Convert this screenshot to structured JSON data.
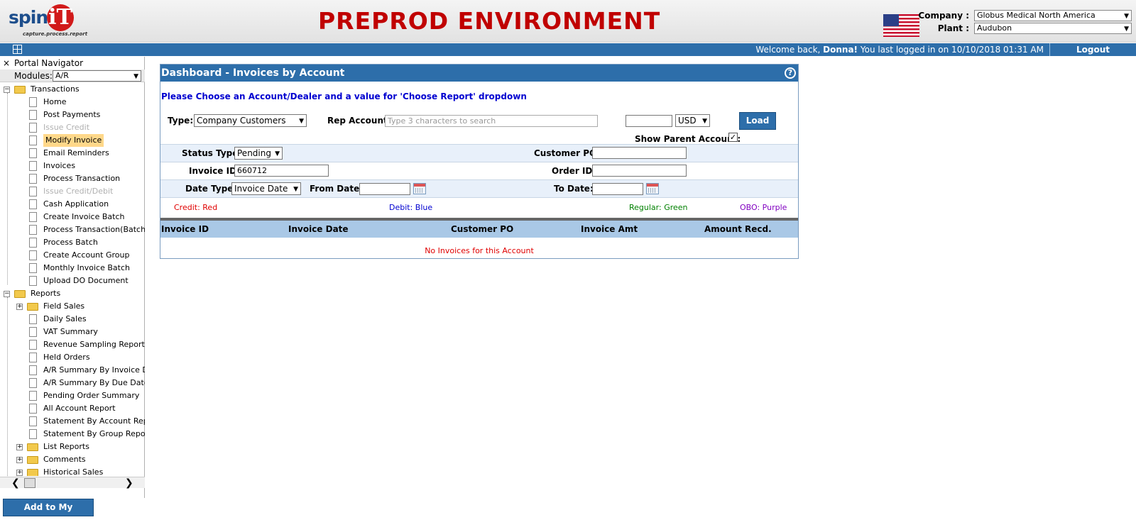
{
  "header": {
    "logo_text": "spine",
    "logo_mark": "iT",
    "logo_tagline": "capture.process.report",
    "environment_banner": "PREPROD ENVIRONMENT",
    "flag_icon": "us-flag-icon",
    "company_label": "Company :",
    "company_value": "Globus Medical North America",
    "plant_label": "Plant :",
    "plant_value": "Audubon"
  },
  "topbar": {
    "welcome_prefix": "Welcome back, ",
    "user_name": "Donna!",
    "welcome_suffix": " You last logged in on 10/10/2018 01:31 AM",
    "logout_label": "Logout"
  },
  "sidebar": {
    "title": "Portal Navigator",
    "close_glyph": "×",
    "modules_label": "Modules:",
    "modules_value": "A/R",
    "transactions": {
      "label": "Transactions",
      "items": [
        {
          "label": "Home",
          "state": "normal"
        },
        {
          "label": "Post Payments",
          "state": "normal"
        },
        {
          "label": "Issue Credit",
          "state": "disabled"
        },
        {
          "label": "Modify Invoice",
          "state": "selected"
        },
        {
          "label": "Email Reminders",
          "state": "normal"
        },
        {
          "label": "Invoices",
          "state": "normal"
        },
        {
          "label": "Process Transaction",
          "state": "normal"
        },
        {
          "label": "Issue Credit/Debit",
          "state": "disabled"
        },
        {
          "label": "Cash Application",
          "state": "normal"
        },
        {
          "label": "Create Invoice Batch",
          "state": "normal"
        },
        {
          "label": "Process Transaction(Batch)",
          "state": "normal"
        },
        {
          "label": "Process Batch",
          "state": "normal"
        },
        {
          "label": "Create Account Group",
          "state": "normal"
        },
        {
          "label": "Monthly Invoice Batch",
          "state": "normal"
        },
        {
          "label": "Upload DO Document",
          "state": "normal"
        }
      ]
    },
    "reports": {
      "label": "Reports",
      "items": [
        {
          "label": "Field Sales",
          "type": "folder"
        },
        {
          "label": "Daily Sales",
          "type": "doc"
        },
        {
          "label": "VAT Summary",
          "type": "doc"
        },
        {
          "label": "Revenue Sampling Report",
          "type": "doc"
        },
        {
          "label": "Held Orders",
          "type": "doc"
        },
        {
          "label": "A/R Summary By Invoice Date",
          "type": "doc"
        },
        {
          "label": "A/R Summary By Due Date",
          "type": "doc"
        },
        {
          "label": "Pending Order Summary",
          "type": "doc"
        },
        {
          "label": "All Account Report",
          "type": "doc"
        },
        {
          "label": "Statement By Account Report",
          "type": "doc"
        },
        {
          "label": "Statement By Group Report",
          "type": "doc"
        },
        {
          "label": "List Reports",
          "type": "folder"
        },
        {
          "label": "Comments",
          "type": "folder"
        },
        {
          "label": "Historical Sales",
          "type": "folder"
        }
      ]
    },
    "favorites_button": "Add to My Favorites"
  },
  "dashboard": {
    "title": "Dashboard - Invoices by Account",
    "help_glyph": "?",
    "instruction": "Please Choose an Account/Dealer and a value for 'Choose Report' dropdown",
    "type_label": "Type:",
    "type_value": "Company Customers",
    "rep_account_label": "Rep Account:",
    "rep_account_placeholder": "Type 3 characters to search",
    "amount_value": "",
    "currency_value": "USD",
    "load_label": "Load",
    "show_parent_label": "Show Parent Account:",
    "show_parent_checked": "✓",
    "status_type_label": "Status Type:",
    "status_type_value": "Pending",
    "customer_po_label": "Customer PO:",
    "customer_po_value": "",
    "invoice_id_label": "Invoice ID:",
    "invoice_id_value": "660712",
    "order_id_label": "Order ID:",
    "order_id_value": "",
    "date_type_label": "Date Type:",
    "date_type_value": "Invoice Date",
    "from_date_label": "From Date:",
    "from_date_value": "",
    "to_date_label": "To Date:",
    "to_date_value": "",
    "legend": {
      "credit": "Credit: Red",
      "debit": "Debit: Blue",
      "regular": "Regular: Green",
      "obo": "OBO: Purple"
    },
    "columns": [
      "Invoice ID",
      "Invoice Date",
      "Customer PO",
      "Invoice Amt",
      "Amount Recd."
    ],
    "empty_message": "No Invoices for this Account"
  },
  "colors": {
    "brand_blue": "#2d6eaa",
    "banner_red": "#c00000",
    "credit": "#e00000",
    "debit": "#0000d0",
    "regular": "#008000",
    "obo": "#8000c0"
  }
}
